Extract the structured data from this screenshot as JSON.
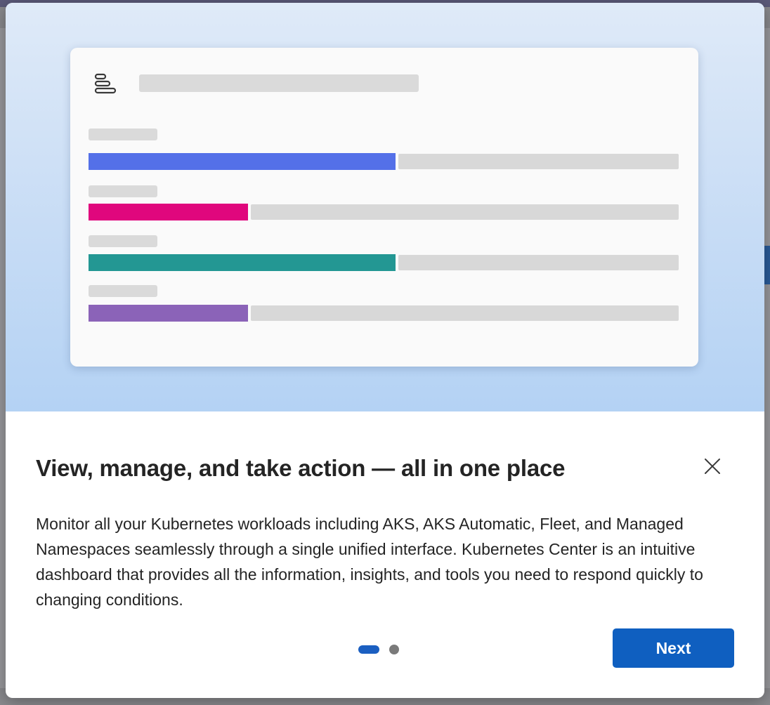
{
  "dialog": {
    "title": "View, manage, and take action — all in one place",
    "description": "Monitor all your Kubernetes workloads including AKS, AKS Automatic, Fleet, and Managed Namespaces seamlessly through a single unified interface. Kubernetes Center is an intuitive dashboard that provides all the information, insights, and tools you need to respond quickly to changing conditions.",
    "next_label": "Next",
    "close_icon": "close-icon",
    "pager": {
      "current_page": 1,
      "total_pages": 2
    }
  },
  "illustration": {
    "icon": "list-icon",
    "bars": [
      {
        "color": "#5470e8",
        "fill_fraction": 0.52
      },
      {
        "color": "#e0077d",
        "fill_fraction": 0.27
      },
      {
        "color": "#239793",
        "fill_fraction": 0.52
      },
      {
        "color": "#8b63b8",
        "fill_fraction": 0.27
      }
    ]
  },
  "colors": {
    "accent": "#0f5fc0",
    "hero_gradient_top": "#dfeaf8",
    "hero_gradient_bottom": "#b4d2f4"
  }
}
